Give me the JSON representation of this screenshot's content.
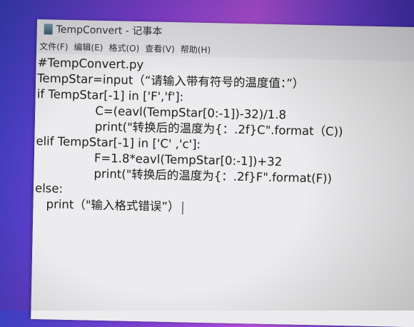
{
  "window": {
    "title": "TempConvert - 记事本",
    "icon": "notepad-icon"
  },
  "menu": [
    "文件(F)",
    "编辑(E)",
    "格式(O)",
    "查看(V)",
    "帮助(H)"
  ],
  "editor": {
    "lines": [
      "#TempConvert.py",
      "TempStar=input（“请输入带有符号的温度值：”）",
      "if TempStar[-1] in ['F','f']:",
      "C=(eavl(TempStar[0:-1])-32)/1.8",
      "print(\"转换后的温度为{：.2f}C\".format（C))",
      "elif TempStar[-1] in ['C' ,'c']:",
      "F=1.8*eavl(TempStar[0:-1])+32",
      "print(\"转换后的温度为{：.2f}F\".format(F))",
      "else:",
      "print（\"输入格式错误”）"
    ]
  }
}
